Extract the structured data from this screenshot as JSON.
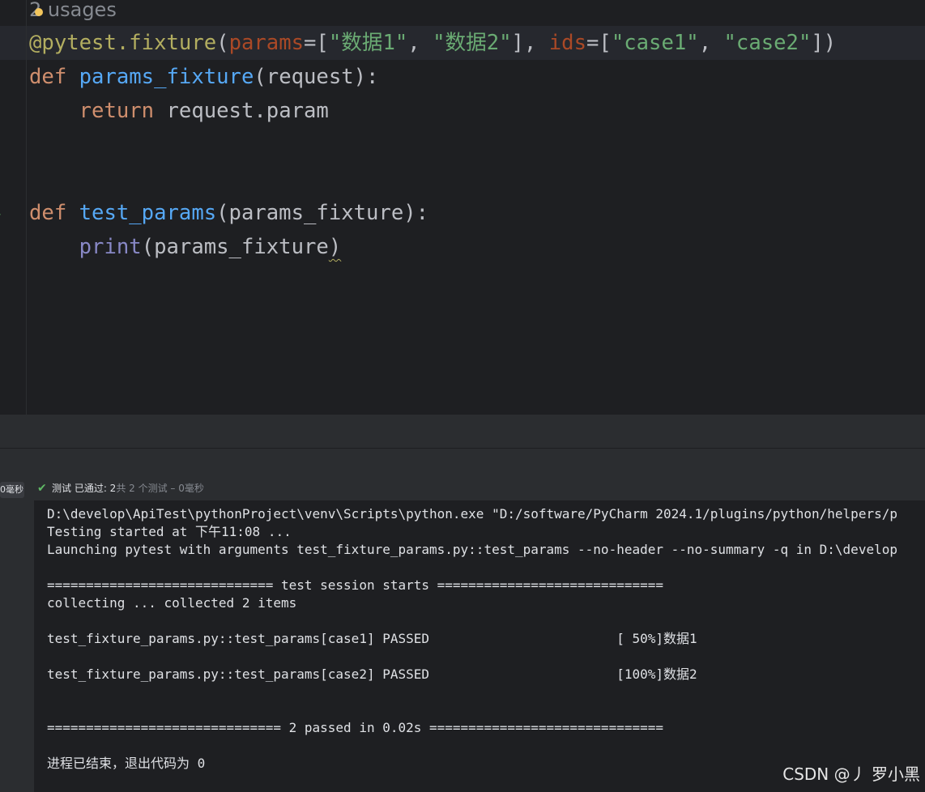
{
  "editor": {
    "usages_hint": "2 usages",
    "lines": [
      {
        "tokens": [
          {
            "cls": "dec",
            "text": "@pytest.fixture"
          },
          {
            "cls": "plain",
            "text": "("
          },
          {
            "cls": "param",
            "text": "params"
          },
          {
            "cls": "plain",
            "text": "=["
          },
          {
            "cls": "str",
            "text": "\"数据1\""
          },
          {
            "cls": "plain",
            "text": ", "
          },
          {
            "cls": "str",
            "text": "\"数据2\""
          },
          {
            "cls": "plain",
            "text": "], "
          },
          {
            "cls": "param",
            "text": "ids"
          },
          {
            "cls": "plain",
            "text": "=["
          },
          {
            "cls": "str",
            "text": "\"case1\""
          },
          {
            "cls": "plain",
            "text": ", "
          },
          {
            "cls": "str",
            "text": "\"case2\""
          },
          {
            "cls": "plain",
            "text": "])"
          }
        ]
      },
      {
        "tokens": [
          {
            "cls": "kw",
            "text": "def "
          },
          {
            "cls": "fn",
            "text": "params_fixture"
          },
          {
            "cls": "plain",
            "text": "(request):"
          }
        ]
      },
      {
        "tokens": [
          {
            "cls": "plain",
            "text": "    "
          },
          {
            "cls": "kw",
            "text": "return "
          },
          {
            "cls": "plain",
            "text": "request.param"
          }
        ]
      },
      {
        "tokens": []
      },
      {
        "tokens": []
      },
      {
        "tokens": [
          {
            "cls": "kw",
            "text": "def "
          },
          {
            "cls": "fn",
            "text": "test_params"
          },
          {
            "cls": "plain",
            "text": "(params_fixture):"
          }
        ]
      },
      {
        "tokens": [
          {
            "cls": "plain",
            "text": "    "
          },
          {
            "cls": "builtin",
            "text": "print"
          },
          {
            "cls": "plain",
            "text": "(params_fixture"
          },
          {
            "cls": "plain squiggle",
            "text": ")"
          }
        ]
      }
    ]
  },
  "test_runner": {
    "time_badge": "0毫秒",
    "status_prefix": "测试 已通过: 2",
    "status_suffix": "共 2 个测试 – 0毫秒"
  },
  "console": {
    "lines": [
      "D:\\develop\\ApiTest\\pythonProject\\venv\\Scripts\\python.exe \"D:/software/PyCharm 2024.1/plugins/python/helpers/p",
      "Testing started at 下午11:08 ...",
      "Launching pytest with arguments test_fixture_params.py::test_params --no-header --no-summary -q in D:\\develop",
      "",
      "============================= test session starts =============================",
      "collecting ... collected 2 items",
      "",
      "test_fixture_params.py::test_params[case1] PASSED                        [ 50%]数据1",
      "",
      "test_fixture_params.py::test_params[case2] PASSED                        [100%]数据2",
      "",
      "",
      "============================== 2 passed in 0.02s ==============================",
      "",
      "进程已结束，退出代码为 0"
    ]
  },
  "watermark": "CSDN @丿 罗小黑",
  "colors": {
    "background": "#1e1f22",
    "keyword": "#cf8e6d",
    "function": "#56a8f5",
    "decorator": "#b3ae60",
    "parameter": "#aa4926",
    "string": "#6aab73",
    "builtin": "#8888c6",
    "passed": "#5fb865"
  },
  "icons": {
    "run_marker": "run-gutter-icon",
    "intention": "lightbulb-icon",
    "status": "check-icon"
  }
}
